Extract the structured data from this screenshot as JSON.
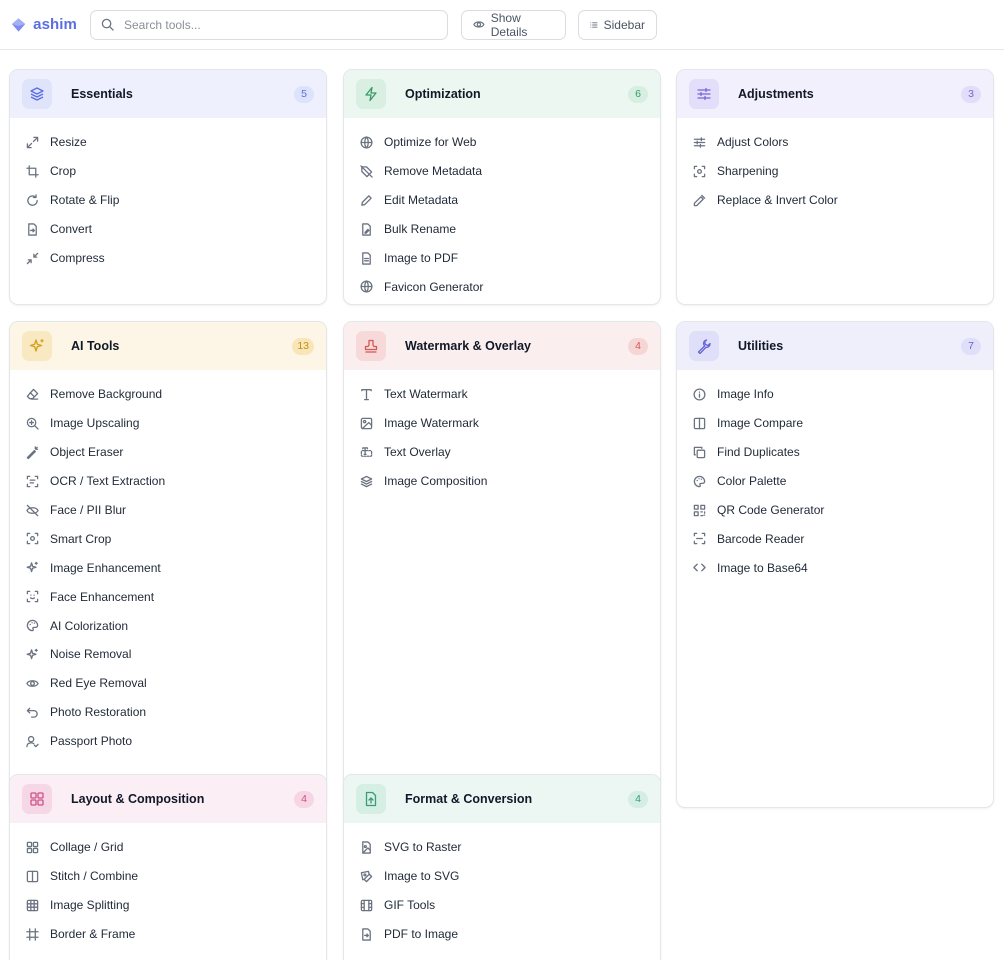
{
  "app": {
    "name": "ashim"
  },
  "search": {
    "placeholder": "Search tools..."
  },
  "toolbar": {
    "details_label": "Show Details",
    "sidebar_label": "Sidebar"
  },
  "colors": {
    "accent": "#5b6ee1",
    "essentials": "#eef1fd",
    "optimization": "#ecf7f1",
    "adjustments": "#f2f0fc",
    "ai": "#fdf6e7",
    "watermark": "#fbeeee",
    "utilities": "#efeffc",
    "layout": "#fbeef5",
    "format": "#ecf7f3"
  },
  "categories": [
    {
      "title": "Essentials",
      "count": "5",
      "icon": "layers-icon",
      "items": [
        "Resize",
        "Crop",
        "Rotate & Flip",
        "Convert",
        "Compress"
      ]
    },
    {
      "title": "Optimization",
      "count": "6",
      "icon": "zap-icon",
      "items": [
        "Optimize for Web",
        "Remove Metadata",
        "Edit Metadata",
        "Bulk Rename",
        "Image to PDF",
        "Favicon Generator"
      ]
    },
    {
      "title": "Adjustments",
      "count": "3",
      "icon": "sliders-icon",
      "items": [
        "Adjust Colors",
        "Sharpening",
        "Replace & Invert Color"
      ]
    },
    {
      "title": "AI Tools",
      "count": "13",
      "icon": "sparkles-icon",
      "items": [
        "Remove Background",
        "Image Upscaling",
        "Object Eraser",
        "OCR / Text Extraction",
        "Face / PII Blur",
        "Smart Crop",
        "Image Enhancement",
        "Face Enhancement",
        "AI Colorization",
        "Noise Removal",
        "Red Eye Removal",
        "Photo Restoration",
        "Passport Photo"
      ]
    },
    {
      "title": "Watermark & Overlay",
      "count": "4",
      "icon": "stamp-icon",
      "items": [
        "Text Watermark",
        "Image Watermark",
        "Text Overlay",
        "Image Composition"
      ]
    },
    {
      "title": "Utilities",
      "count": "7",
      "icon": "wrench-icon",
      "items": [
        "Image Info",
        "Image Compare",
        "Find Duplicates",
        "Color Palette",
        "QR Code Generator",
        "Barcode Reader",
        "Image to Base64"
      ]
    },
    {
      "title": "Layout & Composition",
      "count": "4",
      "icon": "grid-icon",
      "items": [
        "Collage / Grid",
        "Stitch / Combine",
        "Image Splitting",
        "Border & Frame"
      ]
    },
    {
      "title": "Format & Conversion",
      "count": "4",
      "icon": "file-convert-icon",
      "items": [
        "SVG to Raster",
        "Image to SVG",
        "GIF Tools",
        "PDF to Image"
      ]
    }
  ]
}
